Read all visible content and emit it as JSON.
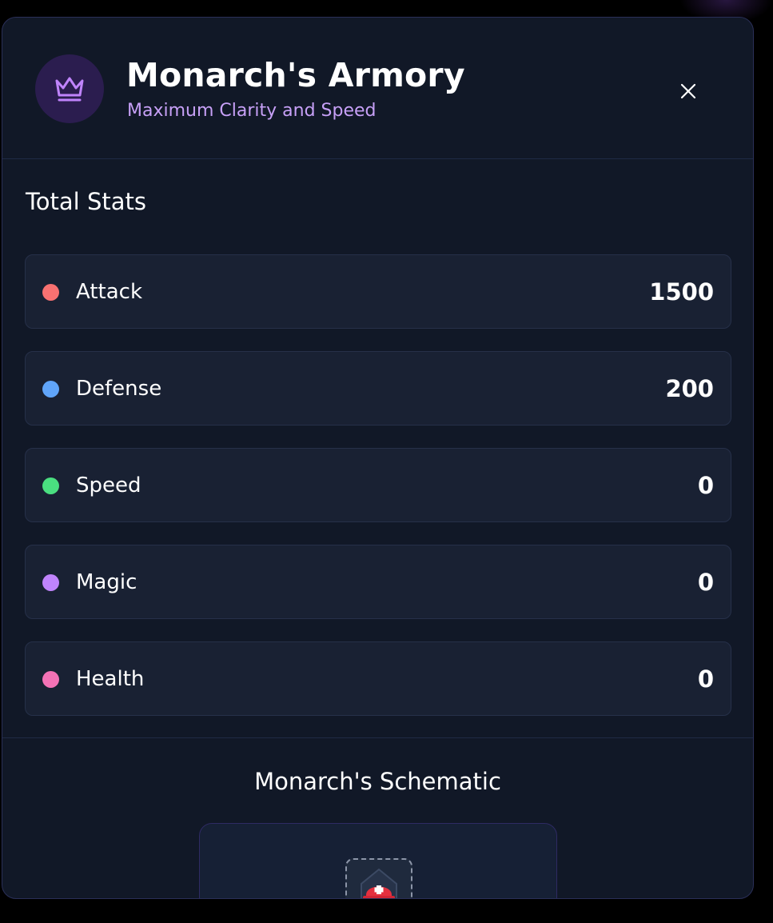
{
  "header": {
    "title": "Monarch's Armory",
    "subtitle": "Maximum Clarity and Speed",
    "icon": "crown-icon",
    "close_icon": "close-icon"
  },
  "stats": {
    "title": "Total Stats",
    "items": [
      {
        "label": "Attack",
        "value": "1500",
        "color": "#f87171"
      },
      {
        "label": "Defense",
        "value": "200",
        "color": "#60a5fa"
      },
      {
        "label": "Speed",
        "value": "0",
        "color": "#4ade80"
      },
      {
        "label": "Magic",
        "value": "0",
        "color": "#c084fc"
      },
      {
        "label": "Health",
        "value": "0",
        "color": "#f472b6"
      }
    ]
  },
  "schematic": {
    "title": "Monarch's Schematic",
    "slot_icon": "helmet-icon"
  },
  "colors": {
    "accent": "#c084fc",
    "background": "#111827",
    "panel": "#192133"
  }
}
